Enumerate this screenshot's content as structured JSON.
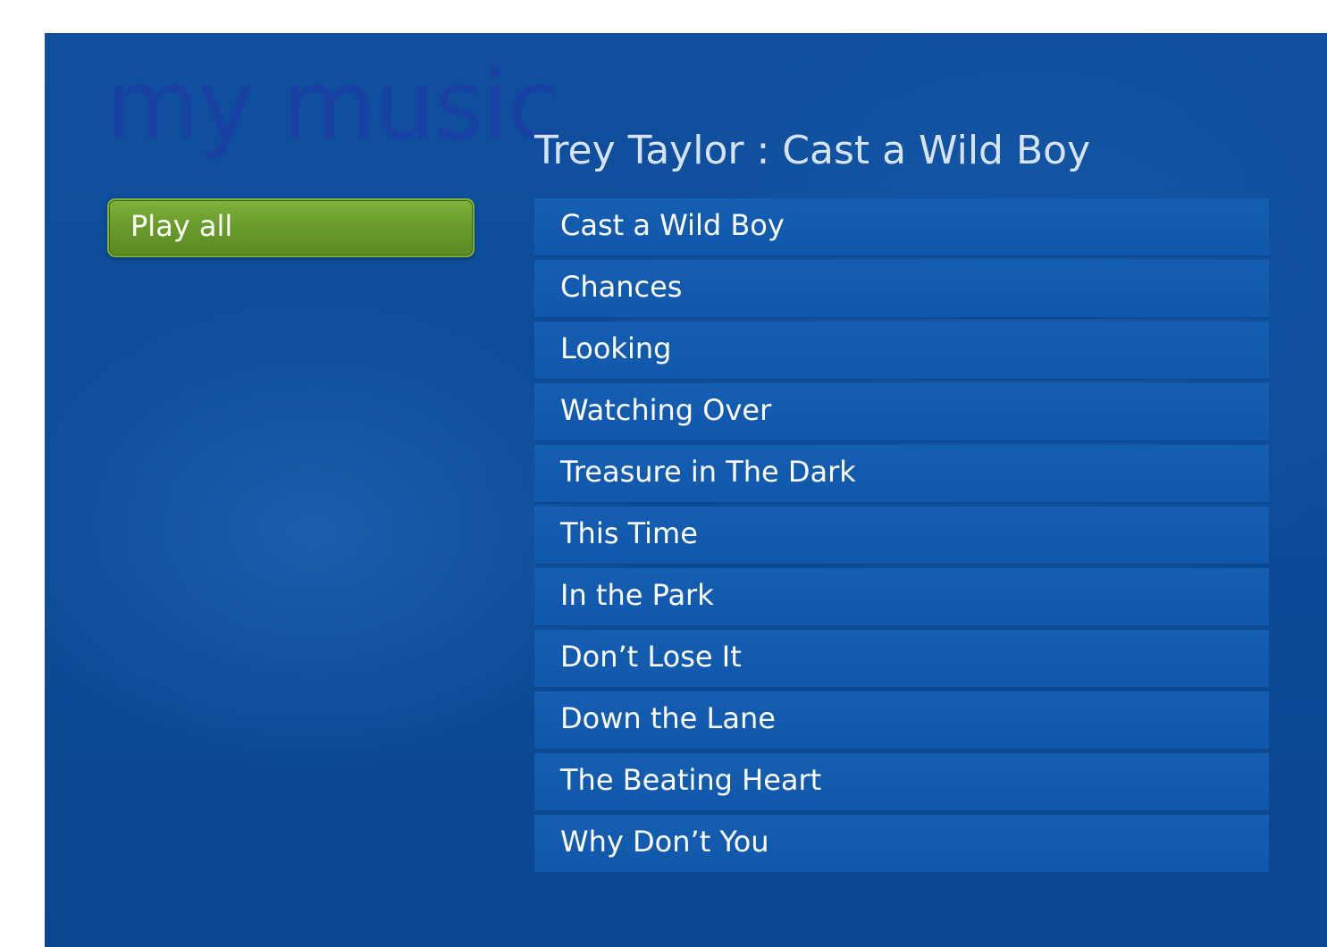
{
  "page": {
    "section_title": "my music",
    "album_header": "Trey Taylor : Cast a Wild Boy"
  },
  "actions": {
    "play_all_label": "Play all"
  },
  "tracks": [
    {
      "title": "Cast a Wild Boy"
    },
    {
      "title": "Chances"
    },
    {
      "title": "Looking"
    },
    {
      "title": "Watching Over"
    },
    {
      "title": "Treasure in The Dark"
    },
    {
      "title": "This Time"
    },
    {
      "title": "In the Park"
    },
    {
      "title": "Don’t Lose It"
    },
    {
      "title": "Down the Lane"
    },
    {
      "title": "The Beating Heart"
    },
    {
      "title": "Why Don’t You"
    }
  ],
  "colors": {
    "background_blue": "#0d4c98",
    "track_row_blue": "#1560b4",
    "play_all_green": "#6a9c2c",
    "title_watermark": "#1a3fa6"
  }
}
